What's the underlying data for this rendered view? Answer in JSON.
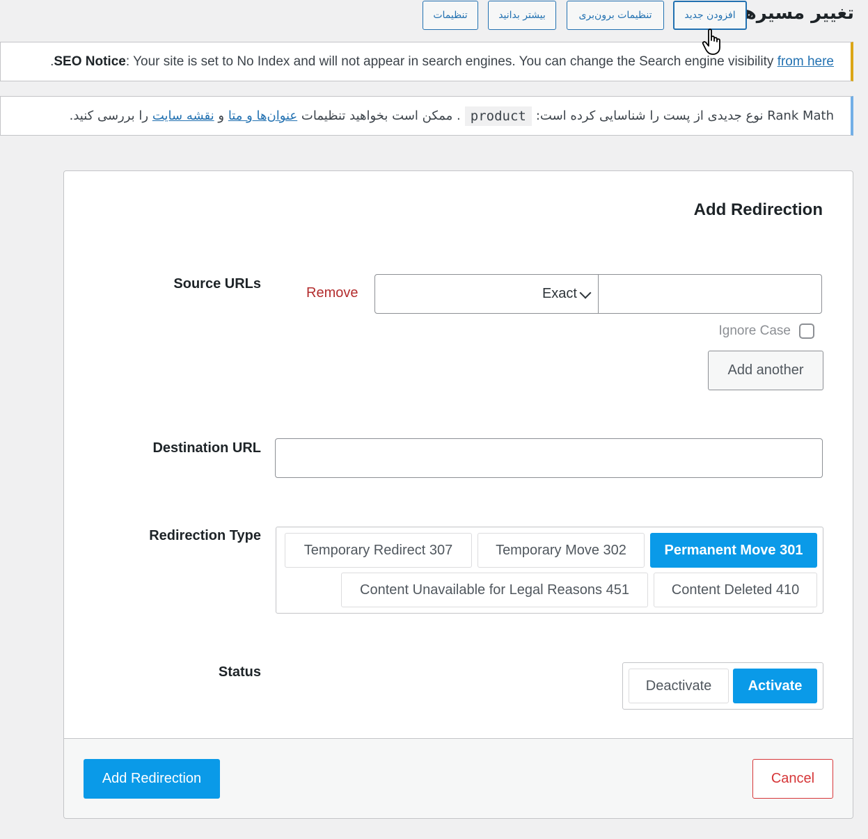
{
  "header": {
    "title": "تغییر مسیرها",
    "buttons": [
      "افزودن جدید",
      "تنظیمات برون‌بری",
      "بیشتر بدانید",
      "تنظیمات"
    ]
  },
  "notices": {
    "seo": {
      "bold": "SEO Notice",
      "text": ": Your site is set to No Index and will not appear in search engines. You can change the Search engine visibility ",
      "link": "from here",
      "trail": "."
    },
    "rankmath": {
      "prefix": "Rank Math نوع جدیدی از پست را شناسایی کرده است:",
      "code": "product",
      "middle": ". ممکن است بخواهید تنظیمات",
      "link1": "عنوان‌ها و متا",
      "and": "و",
      "link2": "نقشه سایت",
      "suffix": "را بررسی کنید."
    }
  },
  "form": {
    "title": "Add Redirection",
    "source_label": "Source URLs",
    "remove_label": "Remove",
    "match_type": "Exact",
    "ignore_case_label": "Ignore Case",
    "add_another_label": "Add another",
    "destination_label": "Destination URL",
    "type_label": "Redirection Type",
    "types": [
      {
        "label": "Permanent Move 301",
        "selected": true
      },
      {
        "label": "Temporary Move 302",
        "selected": false
      },
      {
        "label": "Temporary Redirect 307",
        "selected": false
      },
      {
        "label": "Content Deleted 410",
        "selected": false
      },
      {
        "label": "Content Unavailable for Legal Reasons 451",
        "selected": false
      }
    ],
    "status_label": "Status",
    "status": [
      {
        "label": "Activate",
        "selected": true
      },
      {
        "label": "Deactivate",
        "selected": false
      }
    ],
    "submit_label": "Add Redirection",
    "cancel_label": "Cancel"
  },
  "colors": {
    "accent": "#0a9ae8",
    "link": "#2271b1",
    "danger": "#d63638",
    "seo_notice_border": "#dba617",
    "info_notice_border": "#72aee6"
  }
}
